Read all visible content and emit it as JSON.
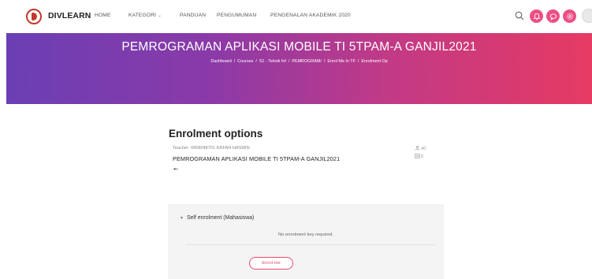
{
  "brand": "DIVLEARN",
  "nav": {
    "items": [
      {
        "label": "HOME"
      },
      {
        "label": "KATEGORI",
        "caret": "⌄"
      },
      {
        "label": "PANDUAN"
      },
      {
        "label": "PENGUMUMAN"
      },
      {
        "label": "PENGENALAN AKADEMIK 2020"
      }
    ],
    "icons": [
      "search-icon",
      "notification-icon",
      "messages-icon",
      "settings-icon"
    ]
  },
  "hero": {
    "title": "PEMROGRAMAN APLIKASI MOBILE TI 5TPAM-A GANJIL2021",
    "breadcrumb": [
      "Dashboard",
      "Courses",
      "S1 - Teknik Inf",
      "PEMROGRAM/",
      "Enrol Me In TF",
      "Enrolment Op"
    ],
    "separator": "/"
  },
  "enrolment": {
    "title": "Enrolment options",
    "teacher": "Teacher: 0908048701 ERFAN HASMIN",
    "course_name": "PEMROGRAMAN APLIKASI MOBILE TI 5TPAM-A GANJIL2021",
    "participants": "40",
    "activities": "5"
  },
  "self_enrolment": {
    "title": "Self enrolment (Mahasiswa)",
    "arrow": "▼",
    "note": "No enrolment key required.",
    "button_label": "Enrol me"
  },
  "colors": {
    "accent": "#ec4f83",
    "hero_start": "#6a3fb4",
    "hero_end": "#e63a63",
    "button": "#e64b6f"
  }
}
